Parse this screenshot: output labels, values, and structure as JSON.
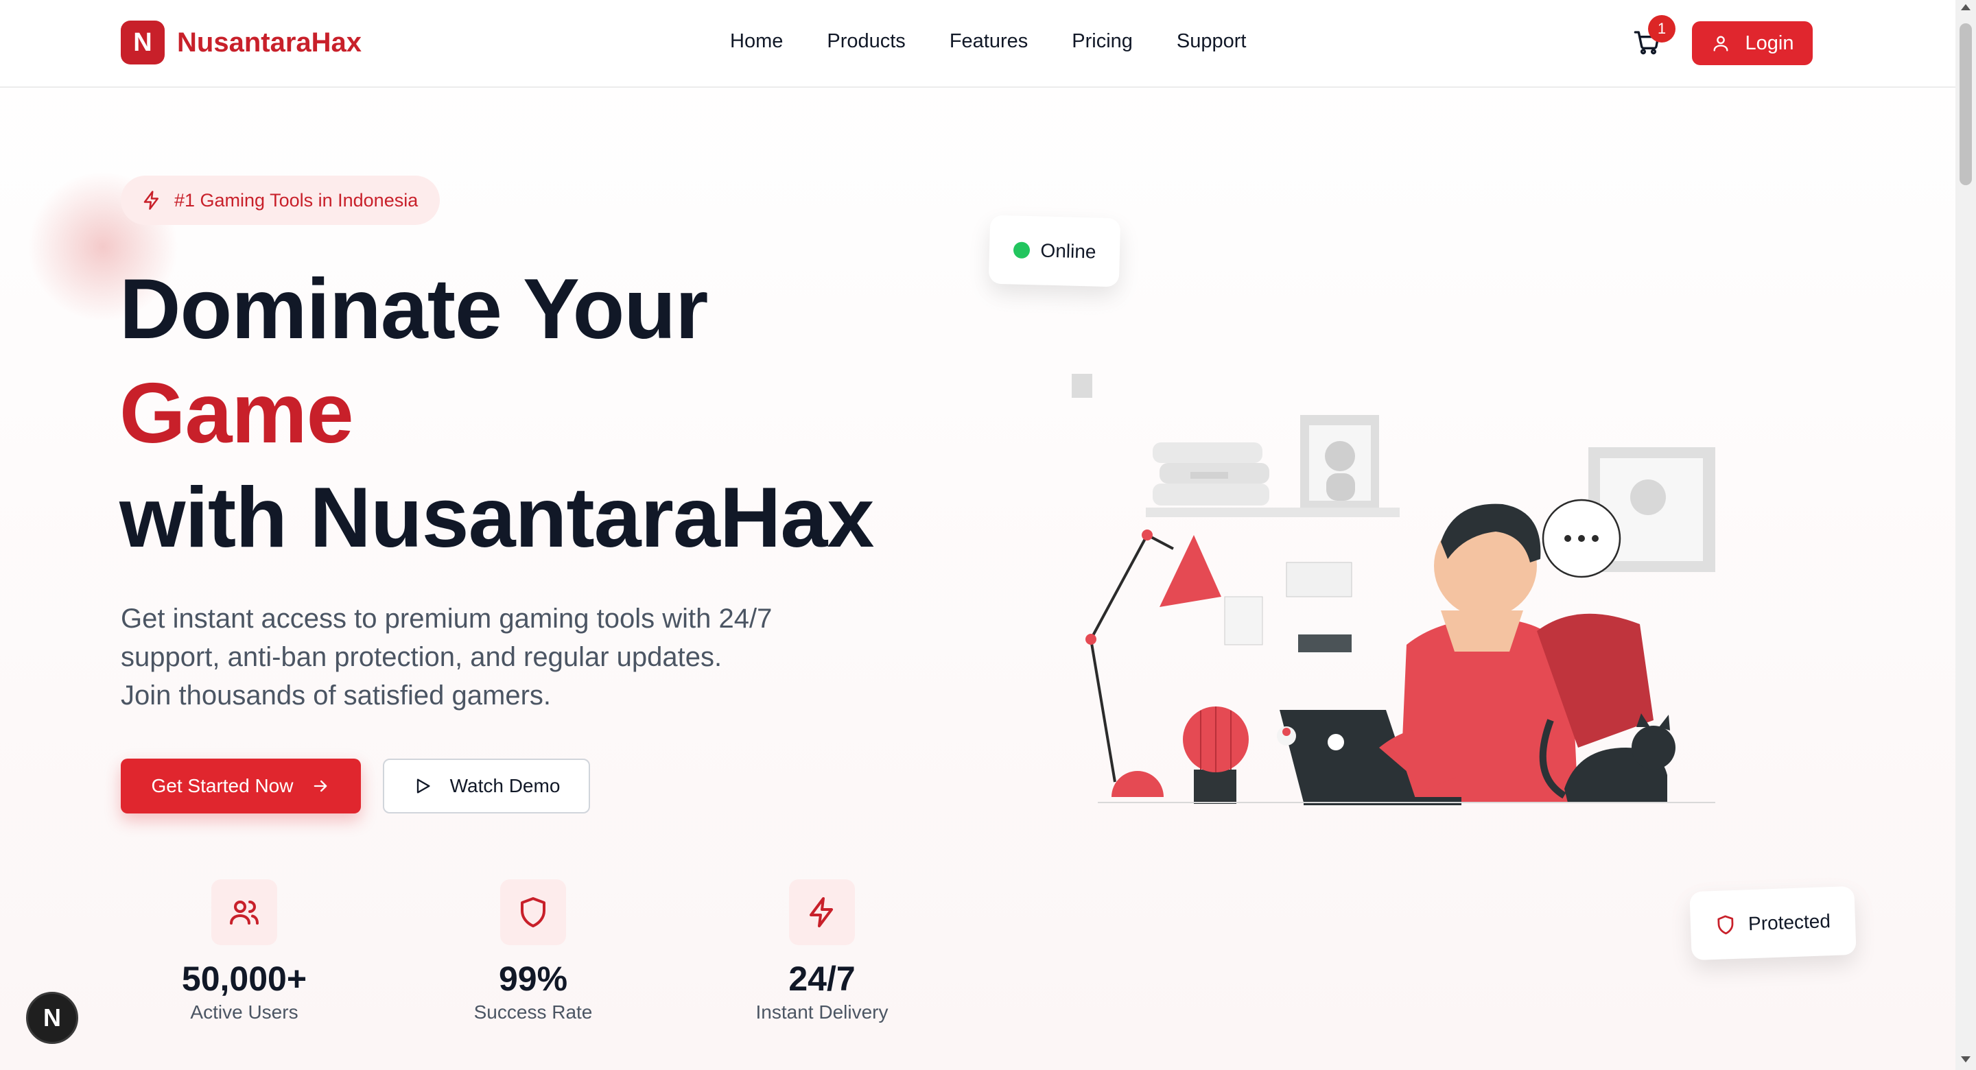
{
  "header": {
    "logo_letter": "N",
    "brand": "NusantaraHax",
    "nav": [
      "Home",
      "Products",
      "Features",
      "Pricing",
      "Support"
    ],
    "cart_count": "1",
    "login_label": "Login"
  },
  "hero": {
    "badge": "#1 Gaming Tools in Indonesia",
    "title_line1": "Dominate Your",
    "title_line2": "Game",
    "title_line3": "with NusantaraHax",
    "subtitle_line1": "Get instant access to premium gaming tools with 24/7",
    "subtitle_line2": "support, anti-ban protection, and regular updates.",
    "subtitle_line3": "Join thousands of satisfied gamers.",
    "cta_primary": "Get Started Now",
    "cta_secondary": "Watch Demo"
  },
  "stats": [
    {
      "icon": "users-icon",
      "value": "50,000+",
      "label": "Active Users"
    },
    {
      "icon": "shield-icon",
      "value": "99%",
      "label": "Success Rate"
    },
    {
      "icon": "lightning-icon",
      "value": "24/7",
      "label": "Instant Delivery"
    }
  ],
  "floating": {
    "online_label": "Online",
    "protected_label": "Protected"
  },
  "dev_badge": "N",
  "colors": {
    "brand_red": "#c8202a",
    "button_red": "#e0262e",
    "online_green": "#22c55e",
    "text_dark": "#111827",
    "text_muted": "#4b5563"
  }
}
